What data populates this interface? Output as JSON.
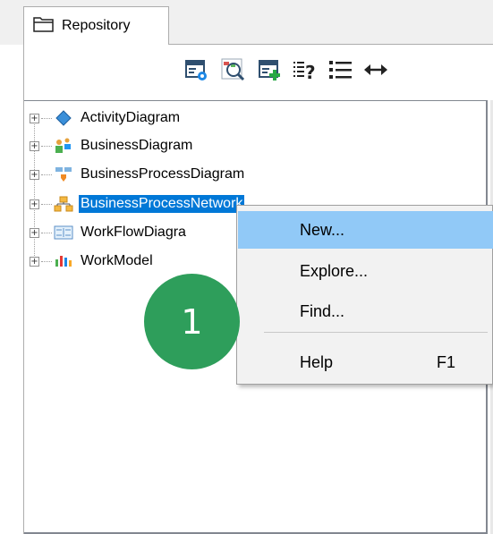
{
  "tab": {
    "label": "Repository",
    "icon": "folder-open-icon"
  },
  "toolbar": {
    "buttons": [
      {
        "name": "properties-settings-button",
        "icon": "window-gear-icon"
      },
      {
        "name": "search-zoom-button",
        "icon": "magnifier-icon"
      },
      {
        "name": "add-item-button",
        "icon": "window-plus-icon"
      },
      {
        "name": "filter-help-button",
        "icon": "list-question-icon"
      },
      {
        "name": "list-view-button",
        "icon": "bullet-list-icon"
      },
      {
        "name": "expand-width-button",
        "icon": "horizontal-arrows-icon"
      }
    ]
  },
  "tree": {
    "items": [
      {
        "label": "ActivityDiagram",
        "icon": "blue-diamond-icon",
        "selected": false
      },
      {
        "label": "BusinessDiagram",
        "icon": "people-icon",
        "selected": false
      },
      {
        "label": "BusinessProcessDiagram",
        "icon": "process-flow-icon",
        "selected": false
      },
      {
        "label": "BusinessProcessNetwork",
        "icon": "network-icon",
        "selected": true
      },
      {
        "label": "WorkFlowDiagra",
        "icon": "workflow-icon",
        "selected": false
      },
      {
        "label": "WorkModel",
        "icon": "bars-icon",
        "selected": false
      }
    ]
  },
  "context_menu": {
    "items": [
      {
        "label": "New...",
        "shortcut": "",
        "highlighted": true
      },
      {
        "label": "Explore...",
        "shortcut": "",
        "highlighted": false
      },
      {
        "label": "Find...",
        "shortcut": "",
        "highlighted": false
      },
      {
        "label": "Help",
        "shortcut": "F1",
        "highlighted": false
      }
    ]
  },
  "step_badge": {
    "number": "1",
    "color": "#2e9e5b"
  },
  "colors": {
    "selection": "#0078d7",
    "menu_hover": "#91c9f7",
    "menu_bg": "#f2f2f2"
  }
}
